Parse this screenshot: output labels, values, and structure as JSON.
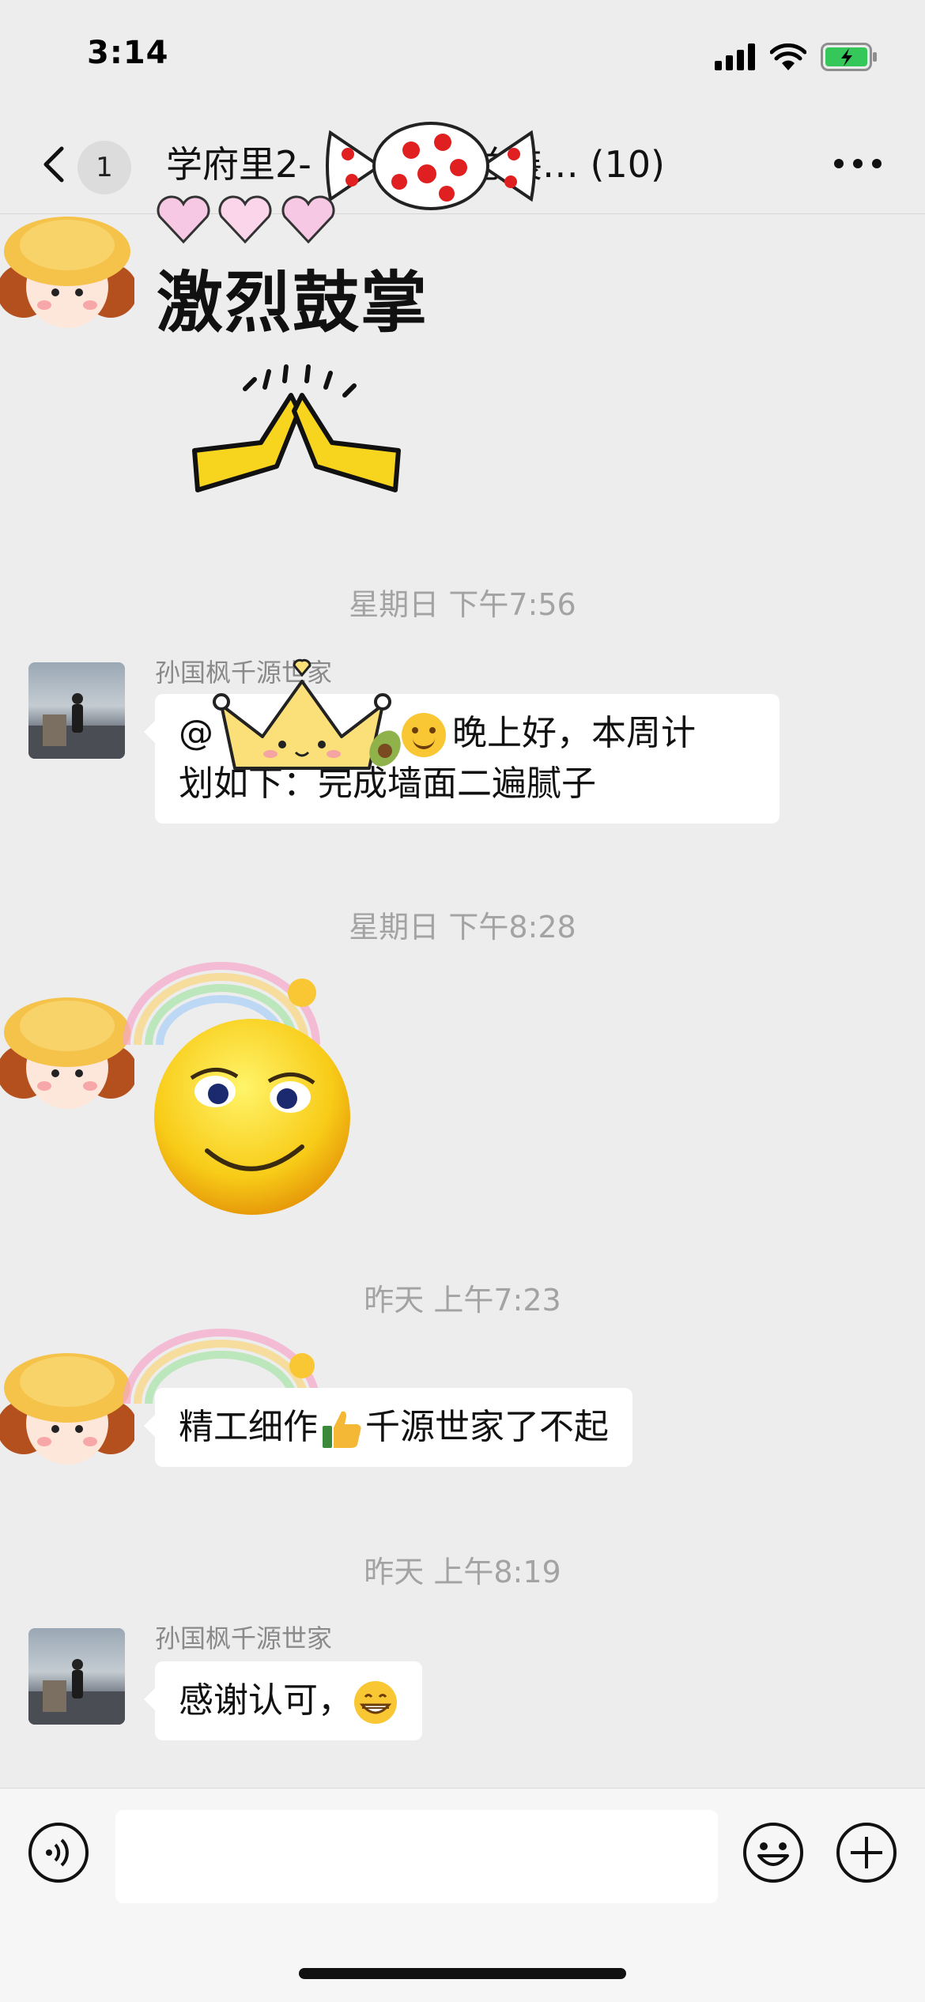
{
  "status_bar": {
    "time": "3:14"
  },
  "header": {
    "back_count": "1",
    "title": "学府里2-",
    "title_suffix": "总装… (10)"
  },
  "messages": [
    {
      "type": "sticker",
      "sticker_text": "激烈鼓掌"
    },
    {
      "type": "timestamp",
      "text": "星期日 下午7:56"
    },
    {
      "type": "text",
      "sender": "孙国枫千源世家",
      "line1_prefix": "@",
      "line1_suffix": "晚上好，本周计",
      "line2": "划如下：完成墙面二遍腻子"
    },
    {
      "type": "timestamp",
      "text": "星期日 下午8:28"
    },
    {
      "type": "sticker"
    },
    {
      "type": "timestamp",
      "text": "昨天 上午7:23"
    },
    {
      "type": "text",
      "text_before": "精工细作",
      "text_after": "千源世家了不起"
    },
    {
      "type": "timestamp",
      "text": "昨天 上午8:19"
    },
    {
      "type": "text",
      "sender": "孙国枫千源世家",
      "text": "感谢认可，"
    }
  ],
  "colors": {
    "background": "#ededed",
    "bubble": "#ffffff",
    "timestamp": "#a3a3a3",
    "sticker_yellow": "#f7d51e"
  },
  "icons": [
    "back-chevron-icon",
    "more-icon",
    "voice-icon",
    "emoji-icon",
    "plus-icon",
    "signal-icon",
    "wifi-icon",
    "battery-icon"
  ]
}
